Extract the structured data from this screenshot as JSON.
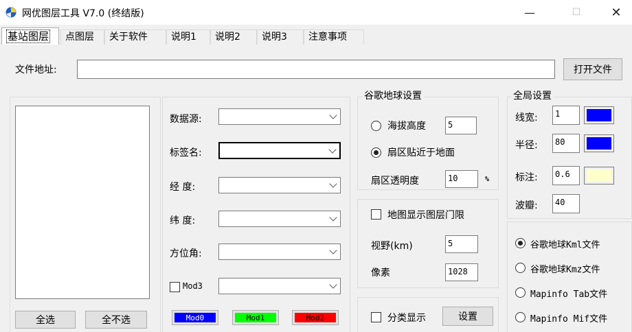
{
  "window": {
    "title": "网优图层工具 V7.0 (终结版)",
    "minimize": "—",
    "maximize": "☐",
    "close": "✕"
  },
  "tabs": [
    {
      "label": "基站图层",
      "active": true
    },
    {
      "label": "点图层"
    },
    {
      "label": "关于软件"
    },
    {
      "label": "说明1"
    },
    {
      "label": "说明2"
    },
    {
      "label": "说明3"
    },
    {
      "label": "注意事项"
    }
  ],
  "file": {
    "label": "文件地址:",
    "value": "",
    "open_button": "打开文件"
  },
  "left_panel": {
    "select_all": "全选",
    "select_none": "全不选"
  },
  "fields": {
    "data_source": {
      "label": "数据源:",
      "value": ""
    },
    "tag_name": {
      "label": "标签名:",
      "value": ""
    },
    "longitude": {
      "label": "经 度:",
      "value": ""
    },
    "latitude": {
      "label": "纬 度:",
      "value": ""
    },
    "azimuth": {
      "label": "方位角:",
      "value": ""
    },
    "mod3": {
      "label": "Mod3",
      "checked": false,
      "value": ""
    }
  },
  "mod_buttons": [
    {
      "label": "Mod0",
      "color": "#0000ff"
    },
    {
      "label": "Mod1",
      "color": "#00ff00"
    },
    {
      "label": "Mod2",
      "color": "#ff0000"
    }
  ],
  "google_earth": {
    "title": "谷歌地球设置",
    "altitude": {
      "label": "海拔高度",
      "value": "5",
      "selected": false
    },
    "near_ground": {
      "label": "扇区贴近于地面",
      "selected": true
    },
    "opacity": {
      "label": "扇区透明度",
      "value": "10",
      "unit": "%"
    }
  },
  "map_limit": {
    "label": "地图显示图层门限",
    "checked": false,
    "view": {
      "label": "视野(km)",
      "value": "5"
    },
    "pixel": {
      "label": "像素",
      "value": "1028"
    }
  },
  "classify": {
    "label": "分类显示",
    "checked": false,
    "button": "设置"
  },
  "global": {
    "title": "全局设置",
    "line_width": {
      "label": "线宽:",
      "value": "1",
      "color": "#0000ff"
    },
    "radius": {
      "label": "半径:",
      "value": "80",
      "color": "#0000ff"
    },
    "annotation": {
      "label": "标注:",
      "value": "0.6",
      "color": "#ffffcc"
    },
    "lobe": {
      "label": "波瓣:",
      "value": "40"
    }
  },
  "output_formats": [
    {
      "label": "谷歌地球Kml文件",
      "selected": true
    },
    {
      "label": "谷歌地球Kmz文件",
      "selected": false
    },
    {
      "label": "Mapinfo Tab文件",
      "selected": false
    },
    {
      "label": "Mapinfo Mif文件",
      "selected": false
    }
  ]
}
